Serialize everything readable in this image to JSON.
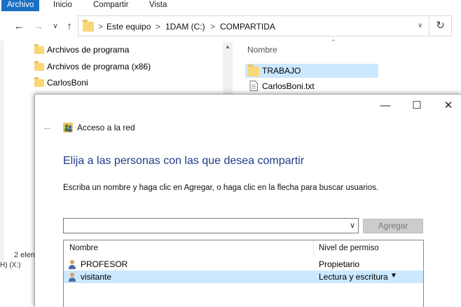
{
  "ribbon": {
    "tabs": [
      "Archivo",
      "Inicio",
      "Compartir",
      "Vista"
    ]
  },
  "address": {
    "crumbs": [
      "Este equipo",
      "1DAM (C:)",
      "COMPARTIDA"
    ],
    "separator": ">"
  },
  "nav_pane": {
    "items": [
      "Archivos de programa",
      "Archivos de programa (x86)",
      "CarlosBoni"
    ]
  },
  "file_list": {
    "column_name": "Nombre",
    "files": [
      {
        "name": "TRABAJO",
        "icon": "folder-icon",
        "selected": true
      },
      {
        "name": "CarlosBoni.txt",
        "icon": "text-file-icon",
        "selected": false
      }
    ]
  },
  "status": {
    "left_text": "2 elem",
    "left_text2": "H) (X:)"
  },
  "dialog": {
    "title": "Acceso a la red",
    "heading": "Elija a las personas con las que desea compartir",
    "instruction": "Escriba un nombre y haga clic en Agregar, o haga clic en la flecha para buscar usuarios.",
    "input_value": "",
    "add_button": "Agregar",
    "table": {
      "col_name": "Nombre",
      "col_perm": "Nivel de permiso",
      "rows": [
        {
          "name": "PROFESOR",
          "permission": "Propietario",
          "selected": false
        },
        {
          "name": "visitante",
          "permission": "Lectura y escritura",
          "selected": true
        }
      ]
    }
  },
  "colors": {
    "accent": "#1a6fc4",
    "selection": "#cce8ff",
    "heading": "#1e3c87"
  }
}
